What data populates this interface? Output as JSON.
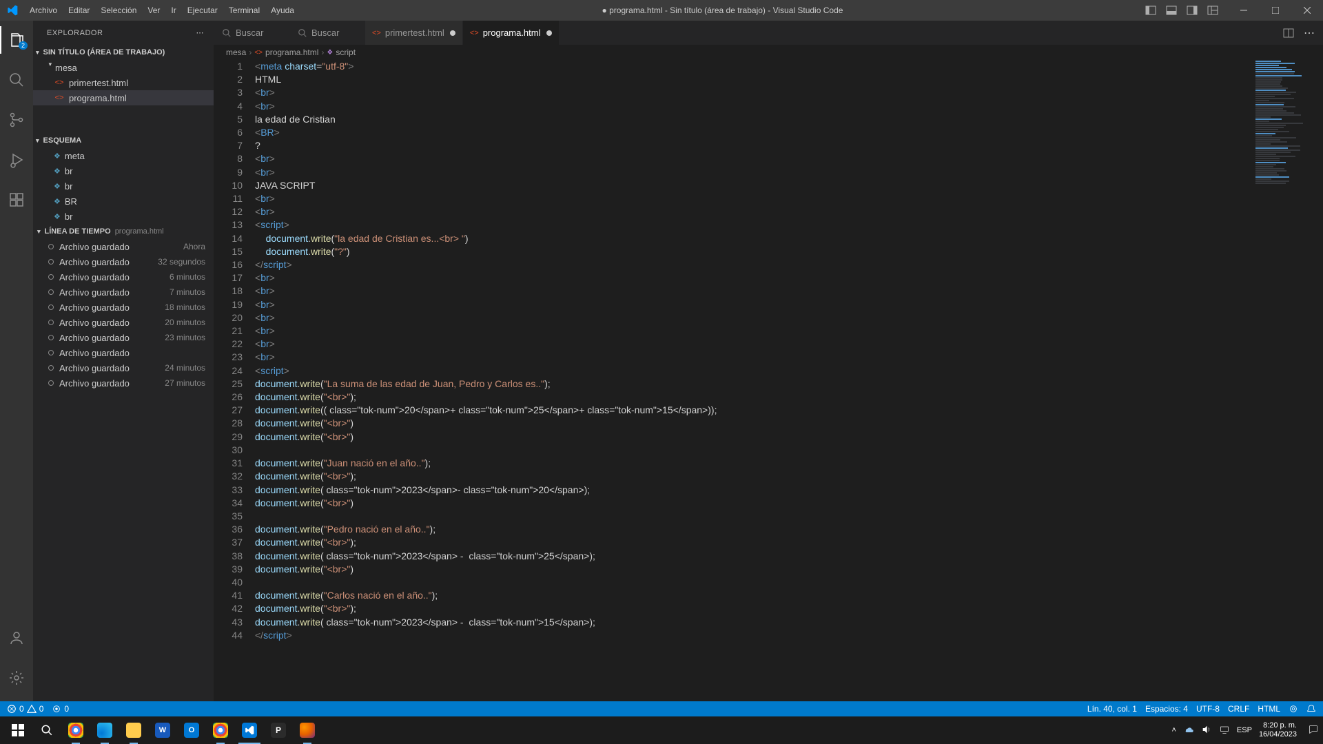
{
  "title_bar": {
    "menus": [
      "Archivo",
      "Editar",
      "Selección",
      "Ver",
      "Ir",
      "Ejecutar",
      "Terminal",
      "Ayuda"
    ],
    "title": "● programa.html - Sin título (área de trabajo) - Visual Studio Code"
  },
  "sidebar": {
    "header": "EXPLORADOR",
    "workspace_title": "SIN TÍTULO (ÁREA DE TRABAJO)",
    "folder": "mesa",
    "files": [
      "primertest.html",
      "programa.html"
    ],
    "selected_file": "programa.html",
    "outline_title": "ESQUEMA",
    "outline_items": [
      "meta",
      "br",
      "br",
      "BR",
      "br"
    ],
    "timeline_title": "LÍNEA DE TIEMPO",
    "timeline_file": "programa.html",
    "timeline": [
      {
        "label": "Archivo guardado",
        "time": "Ahora"
      },
      {
        "label": "Archivo guardado",
        "time": "32 segundos"
      },
      {
        "label": "Archivo guardado",
        "time": "6 minutos"
      },
      {
        "label": "Archivo guardado",
        "time": "7 minutos"
      },
      {
        "label": "Archivo guardado",
        "time": "18 minutos"
      },
      {
        "label": "Archivo guardado",
        "time": "20 minutos"
      },
      {
        "label": "Archivo guardado",
        "time": "23 minutos"
      },
      {
        "label": "Archivo guardado",
        "time": ""
      },
      {
        "label": "Archivo guardado",
        "time": "24 minutos"
      },
      {
        "label": "Archivo guardado",
        "time": "27 minutos"
      }
    ]
  },
  "tabs": {
    "search1": "Buscar",
    "search2": "Buscar",
    "tab1": "primertest.html",
    "tab2": "programa.html"
  },
  "breadcrumbs": {
    "folder": "mesa",
    "file": "programa.html",
    "symbol": "script"
  },
  "code": {
    "lines": [
      {
        "n": 1,
        "t": "meta_tag"
      },
      {
        "n": 2,
        "t": "plain",
        "v": "HTML"
      },
      {
        "n": 3,
        "t": "br"
      },
      {
        "n": 4,
        "t": "br"
      },
      {
        "n": 5,
        "t": "plain",
        "v": "la edad de Cristian"
      },
      {
        "n": 6,
        "t": "BR"
      },
      {
        "n": 7,
        "t": "plain",
        "v": "?"
      },
      {
        "n": 8,
        "t": "br"
      },
      {
        "n": 9,
        "t": "br"
      },
      {
        "n": 10,
        "t": "plain",
        "v": "JAVA SCRIPT"
      },
      {
        "n": 11,
        "t": "br"
      },
      {
        "n": 12,
        "t": "br"
      },
      {
        "n": 13,
        "t": "script_open"
      },
      {
        "n": 14,
        "t": "dw_str_indent",
        "v": "\"la edad de Cristian es...<br> \""
      },
      {
        "n": 15,
        "t": "dw_str_indent",
        "v": "\"?\""
      },
      {
        "n": 16,
        "t": "script_close"
      },
      {
        "n": 17,
        "t": "br"
      },
      {
        "n": 18,
        "t": "br"
      },
      {
        "n": 19,
        "t": "br"
      },
      {
        "n": 20,
        "t": "br"
      },
      {
        "n": 21,
        "t": "br"
      },
      {
        "n": 22,
        "t": "br"
      },
      {
        "n": 23,
        "t": "br"
      },
      {
        "n": 24,
        "t": "script_open"
      },
      {
        "n": 25,
        "t": "dw_str",
        "v": "\"La suma de las edad de Juan, Pedro y Carlos es..\"",
        "semi": true
      },
      {
        "n": 26,
        "t": "dw_str",
        "v": "\"<br>\"",
        "semi": true
      },
      {
        "n": 27,
        "t": "dw_expr",
        "v": "(20+25+15)",
        "semi": true
      },
      {
        "n": 28,
        "t": "dw_str",
        "v": "\"<br>\""
      },
      {
        "n": 29,
        "t": "dw_str",
        "v": "\"<br>\""
      },
      {
        "n": 30,
        "t": "empty"
      },
      {
        "n": 31,
        "t": "dw_str",
        "v": "\"Juan nació en el año..\"",
        "semi": true
      },
      {
        "n": 32,
        "t": "dw_str",
        "v": "\"<br>\"",
        "semi": true
      },
      {
        "n": 33,
        "t": "dw_expr",
        "v": "2023-20",
        "semi": true
      },
      {
        "n": 34,
        "t": "dw_str",
        "v": "\"<br>\""
      },
      {
        "n": 35,
        "t": "empty"
      },
      {
        "n": 36,
        "t": "dw_str",
        "v": "\"Pedro nació en el año..\"",
        "semi": true
      },
      {
        "n": 37,
        "t": "dw_str",
        "v": "\"<br>\"",
        "semi": true
      },
      {
        "n": 38,
        "t": "dw_expr",
        "v": "2023 - 25",
        "semi": true
      },
      {
        "n": 39,
        "t": "dw_str",
        "v": "\"<br>\""
      },
      {
        "n": 40,
        "t": "empty"
      },
      {
        "n": 41,
        "t": "dw_str",
        "v": "\"Carlos nació en el año..\"",
        "semi": true
      },
      {
        "n": 42,
        "t": "dw_str",
        "v": "\"<br>\"",
        "semi": true
      },
      {
        "n": 43,
        "t": "dw_expr",
        "v": "2023 - 15",
        "semi": true
      },
      {
        "n": 44,
        "t": "script_close"
      }
    ]
  },
  "status": {
    "errors": "0",
    "warnings": "0",
    "line_col": "Lín. 40, col. 1",
    "spaces": "Espacios: 4",
    "encoding": "UTF-8",
    "eol": "CRLF",
    "lang": "HTML"
  },
  "taskbar": {
    "lang": "ESP",
    "time": "8:20 p. m.",
    "date": "16/04/2023"
  }
}
